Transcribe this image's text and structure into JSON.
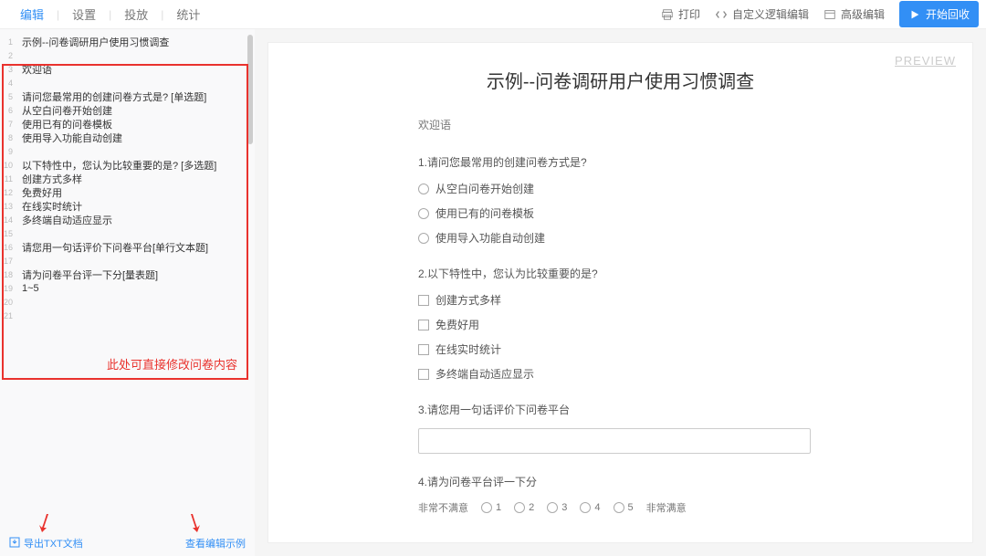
{
  "topbar": {
    "tabs": [
      "编辑",
      "设置",
      "投放",
      "统计"
    ],
    "active_tab_index": 0,
    "right": {
      "print": "打印",
      "logic": "自定义逻辑编辑",
      "advanced": "高级编辑",
      "start": "开始回收"
    }
  },
  "editor": {
    "lines": [
      "示例--问卷调研用户使用习惯调查",
      "",
      "欢迎语",
      "",
      "请问您最常用的创建问卷方式是? [单选题]",
      "从空白问卷开始创建",
      "使用已有的问卷模板",
      "使用导入功能自动创建",
      "",
      "以下特性中，您认为比较重要的是? [多选题]",
      "创建方式多样",
      "免费好用",
      "在线实时统计",
      "多终端自动适应显示",
      "",
      "请您用一句话评价下问卷平台[单行文本题]",
      "",
      "请为问卷平台评一下分[量表题]",
      "1~5",
      "",
      ""
    ],
    "annotation": "此处可直接修改问卷内容"
  },
  "footer": {
    "export": "导出TXT文档",
    "example": "查看编辑示例"
  },
  "preview": {
    "label": "PREVIEW",
    "title": "示例--问卷调研用户使用习惯调查",
    "welcome": "欢迎语",
    "q1": {
      "text": "1.请问您最常用的创建问卷方式是?",
      "options": [
        "从空白问卷开始创建",
        "使用已有的问卷模板",
        "使用导入功能自动创建"
      ]
    },
    "q2": {
      "text": "2.以下特性中，您认为比较重要的是?",
      "options": [
        "创建方式多样",
        "免费好用",
        "在线实时统计",
        "多终端自动适应显示"
      ]
    },
    "q3": {
      "text": "3.请您用一句话评价下问卷平台"
    },
    "q4": {
      "text": "4.请为问卷平台评一下分",
      "left": "非常不满意",
      "right": "非常满意",
      "scale": [
        "1",
        "2",
        "3",
        "4",
        "5"
      ]
    }
  }
}
